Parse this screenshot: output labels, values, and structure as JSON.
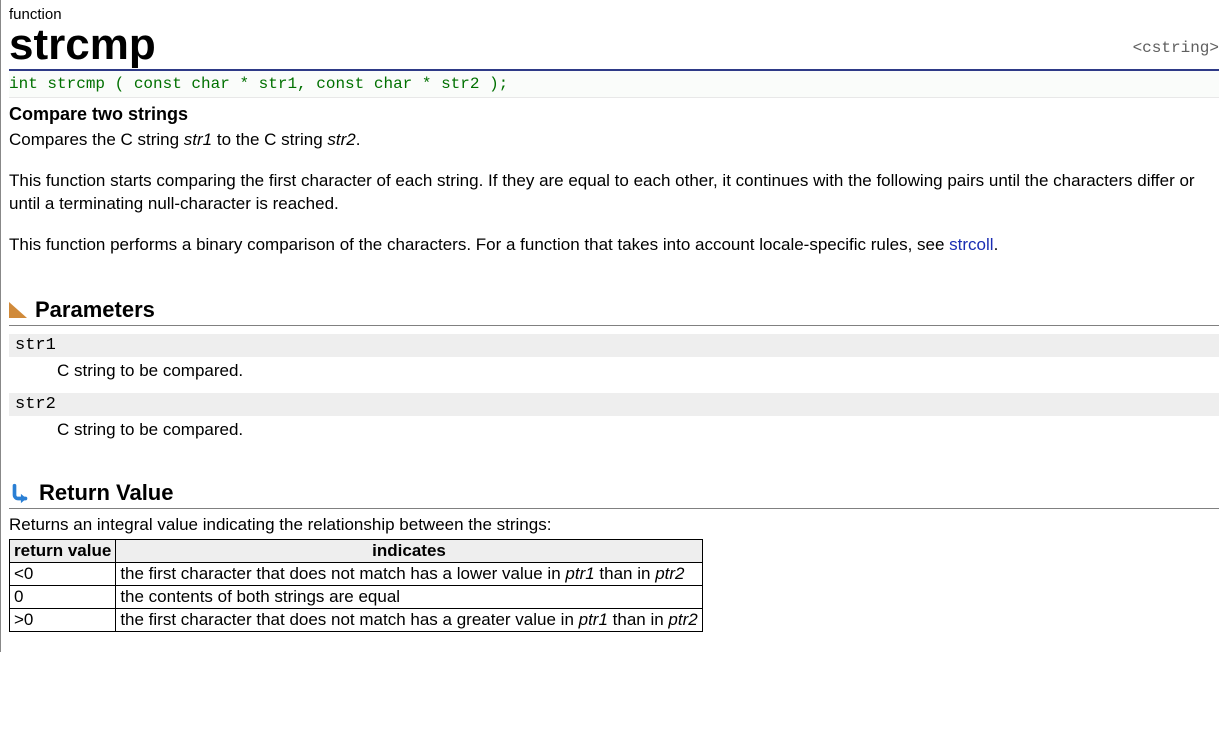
{
  "header": {
    "category": "function",
    "title": "strcmp",
    "library": "<cstring>"
  },
  "signature": "int strcmp ( const char * str1, const char * str2 );",
  "brief": "Compare two strings",
  "description": {
    "p1_a": "Compares the C string ",
    "p1_em1": "str1",
    "p1_b": " to the C string ",
    "p1_em2": "str2",
    "p1_c": ".",
    "p2": "This function starts comparing the first character of each string. If they are equal to each other, it continues with the following pairs until the characters differ or until a terminating null-character is reached.",
    "p3_a": "This function performs a binary comparison of the characters. For a function that takes into account locale-specific rules, see ",
    "p3_link": "strcoll",
    "p3_b": "."
  },
  "sections": {
    "parameters": "Parameters",
    "return_value": "Return Value"
  },
  "parameters": [
    {
      "name": "str1",
      "desc": "C string to be compared."
    },
    {
      "name": "str2",
      "desc": "C string to be compared."
    }
  ],
  "return": {
    "intro": "Returns an integral value indicating the relationship between the strings:",
    "headers": {
      "col1": "return value",
      "col2": "indicates"
    },
    "rows": [
      {
        "val": "<0",
        "pre": "the first character that does not match has a lower value in ",
        "em1": "ptr1",
        "mid": " than in ",
        "em2": "ptr2",
        "post": ""
      },
      {
        "val": "0",
        "pre": "the contents of both strings are equal",
        "em1": "",
        "mid": "",
        "em2": "",
        "post": ""
      },
      {
        "val": ">0",
        "pre": "the first character that does not match has a greater value in ",
        "em1": "ptr1",
        "mid": " than in ",
        "em2": "ptr2",
        "post": ""
      }
    ]
  }
}
